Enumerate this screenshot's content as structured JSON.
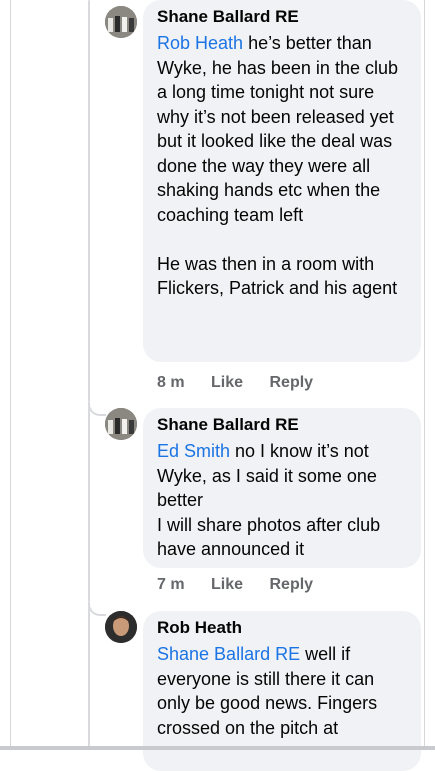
{
  "comments": [
    {
      "author": "Shane Ballard RE",
      "mention": "Rob Heath",
      "text": " he’s better than Wyke, he has been in the club a long time tonight not sure why it’s not been released yet but it looked like the deal was done the way they were all shaking hands etc when the coaching team left\n\nHe was then in a room with Flickers, Patrick and his agent",
      "time": "8 m",
      "like": "Like",
      "reply": "Reply"
    },
    {
      "author": "Shane Ballard RE",
      "mention": "Ed Smith",
      "text": " no I know it’s not Wyke, as I said it some one better\nI will share photos after club have announced it",
      "time": "7 m",
      "like": "Like",
      "reply": "Reply"
    },
    {
      "author": "Rob Heath",
      "mention": "Shane Ballard RE",
      "text": " well if everyone is still there it can only be good news. Fingers crossed on the pitch at",
      "time": "",
      "like": "",
      "reply": ""
    }
  ]
}
